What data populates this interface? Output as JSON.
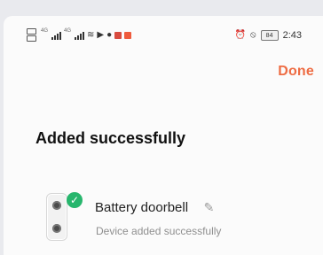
{
  "status_bar": {
    "time": "2:43",
    "battery": "84"
  },
  "header": {
    "done_label": "Done"
  },
  "main": {
    "title": "Added successfully",
    "device": {
      "name": "Battery doorbell",
      "status": "Device added successfully"
    }
  },
  "icons": {
    "edit": "pencil-icon",
    "success": "checkmark-icon",
    "device": "doorbell-icon"
  },
  "colors": {
    "accent": "#ee6c43",
    "success": "#27b66d",
    "background": "#fbfbfb"
  }
}
